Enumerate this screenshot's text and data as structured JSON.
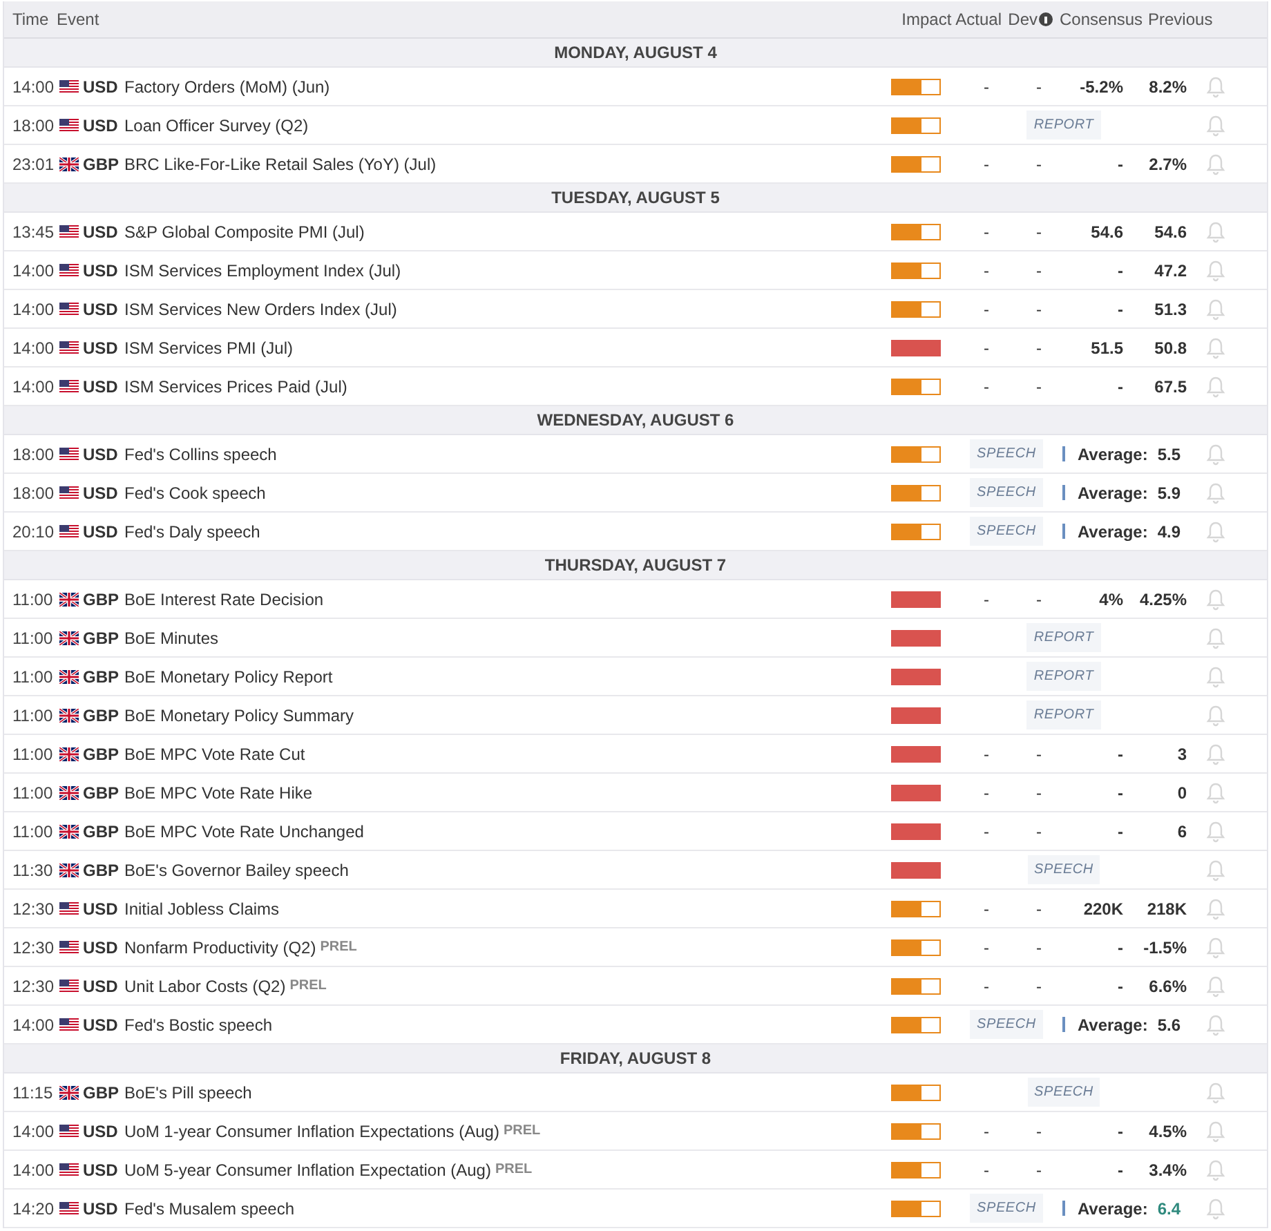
{
  "header": {
    "time": "Time",
    "event": "Event",
    "impact": "Impact",
    "actual": "Actual",
    "dev": "Dev",
    "consensus": "Consensus",
    "previous": "Previous"
  },
  "days": [
    {
      "date": "MONDAY, AUGUST 4",
      "events": [
        {
          "kind": "data",
          "time": "14:00",
          "flag": {
            "kind": "us"
          },
          "currency": "USD",
          "event": "Factory Orders (MoM) (Jun)",
          "impact": {
            "level": 0.62,
            "color": "#e8891c"
          },
          "actual": "-",
          "dev": "-",
          "consensus": "-5.2%",
          "previous": "8.2%"
        },
        {
          "kind": "tag",
          "time": "18:00",
          "flag": {
            "kind": "us"
          },
          "currency": "USD",
          "event": "Loan Officer Survey (Q2)",
          "impact": {
            "level": 0.62,
            "color": "#e8891c"
          },
          "tag": "REPORT"
        },
        {
          "kind": "data",
          "time": "23:01",
          "flag": {
            "kind": "gb"
          },
          "currency": "GBP",
          "event": "BRC Like-For-Like Retail Sales (YoY) (Jul)",
          "impact": {
            "level": 0.62,
            "color": "#e8891c"
          },
          "actual": "-",
          "dev": "-",
          "consensus": "-",
          "previous": "2.7%"
        }
      ]
    },
    {
      "date": "TUESDAY, AUGUST 5",
      "events": [
        {
          "kind": "data",
          "time": "13:45",
          "flag": {
            "kind": "us"
          },
          "currency": "USD",
          "event": "S&P Global Composite PMI (Jul)",
          "impact": {
            "level": 0.62,
            "color": "#e8891c"
          },
          "actual": "-",
          "dev": "-",
          "consensus": "54.6",
          "previous": "54.6"
        },
        {
          "kind": "data",
          "time": "14:00",
          "flag": {
            "kind": "us"
          },
          "currency": "USD",
          "event": "ISM Services Employment Index (Jul)",
          "impact": {
            "level": 0.62,
            "color": "#e8891c"
          },
          "actual": "-",
          "dev": "-",
          "consensus": "-",
          "previous": "47.2"
        },
        {
          "kind": "data",
          "time": "14:00",
          "flag": {
            "kind": "us"
          },
          "currency": "USD",
          "event": "ISM Services New Orders Index (Jul)",
          "impact": {
            "level": 0.62,
            "color": "#e8891c"
          },
          "actual": "-",
          "dev": "-",
          "consensus": "-",
          "previous": "51.3"
        },
        {
          "kind": "data",
          "time": "14:00",
          "flag": {
            "kind": "us"
          },
          "currency": "USD",
          "event": "ISM Services PMI (Jul)",
          "impact": {
            "level": 1,
            "color": "#d9534f"
          },
          "actual": "-",
          "dev": "-",
          "consensus": "51.5",
          "previous": "50.8"
        },
        {
          "kind": "data",
          "time": "14:00",
          "flag": {
            "kind": "us"
          },
          "currency": "USD",
          "event": "ISM Services Prices Paid (Jul)",
          "impact": {
            "level": 0.62,
            "color": "#e8891c"
          },
          "actual": "-",
          "dev": "-",
          "consensus": "-",
          "previous": "67.5"
        }
      ]
    },
    {
      "date": "WEDNESDAY, AUGUST 6",
      "events": [
        {
          "kind": "speech",
          "time": "18:00",
          "flag": {
            "kind": "us"
          },
          "currency": "USD",
          "event": "Fed's Collins speech",
          "impact": {
            "level": 0.62,
            "color": "#e8891c"
          },
          "tag": "SPEECH",
          "average_label": "Average:",
          "average": "5.5",
          "color": "#333333"
        },
        {
          "kind": "speech",
          "time": "18:00",
          "flag": {
            "kind": "us"
          },
          "currency": "USD",
          "event": "Fed's Cook speech",
          "impact": {
            "level": 0.62,
            "color": "#e8891c"
          },
          "tag": "SPEECH",
          "average_label": "Average:",
          "average": "5.9",
          "color": "#333333"
        },
        {
          "kind": "speech",
          "time": "20:10",
          "flag": {
            "kind": "us"
          },
          "currency": "USD",
          "event": "Fed's Daly speech",
          "impact": {
            "level": 0.62,
            "color": "#e8891c"
          },
          "tag": "SPEECH",
          "average_label": "Average:",
          "average": "4.9",
          "color": "#333333"
        }
      ]
    },
    {
      "date": "THURSDAY, AUGUST 7",
      "events": [
        {
          "kind": "data",
          "time": "11:00",
          "flag": {
            "kind": "gb"
          },
          "currency": "GBP",
          "event": "BoE Interest Rate Decision",
          "impact": {
            "level": 1,
            "color": "#d9534f"
          },
          "actual": "-",
          "dev": "-",
          "consensus": "4%",
          "previous": "4.25%"
        },
        {
          "kind": "tag",
          "time": "11:00",
          "flag": {
            "kind": "gb"
          },
          "currency": "GBP",
          "event": "BoE Minutes",
          "impact": {
            "level": 1,
            "color": "#d9534f"
          },
          "tag": "REPORT"
        },
        {
          "kind": "tag",
          "time": "11:00",
          "flag": {
            "kind": "gb"
          },
          "currency": "GBP",
          "event": "BoE Monetary Policy Report",
          "impact": {
            "level": 1,
            "color": "#d9534f"
          },
          "tag": "REPORT"
        },
        {
          "kind": "tag",
          "time": "11:00",
          "flag": {
            "kind": "gb"
          },
          "currency": "GBP",
          "event": "BoE Monetary Policy Summary",
          "impact": {
            "level": 1,
            "color": "#d9534f"
          },
          "tag": "REPORT"
        },
        {
          "kind": "data",
          "time": "11:00",
          "flag": {
            "kind": "gb"
          },
          "currency": "GBP",
          "event": "BoE MPC Vote Rate Cut",
          "impact": {
            "level": 1,
            "color": "#d9534f"
          },
          "actual": "-",
          "dev": "-",
          "consensus": "-",
          "previous": "3"
        },
        {
          "kind": "data",
          "time": "11:00",
          "flag": {
            "kind": "gb"
          },
          "currency": "GBP",
          "event": "BoE MPC Vote Rate Hike",
          "impact": {
            "level": 1,
            "color": "#d9534f"
          },
          "actual": "-",
          "dev": "-",
          "consensus": "-",
          "previous": "0"
        },
        {
          "kind": "data",
          "time": "11:00",
          "flag": {
            "kind": "gb"
          },
          "currency": "GBP",
          "event": "BoE MPC Vote Rate Unchanged",
          "impact": {
            "level": 1,
            "color": "#d9534f"
          },
          "actual": "-",
          "dev": "-",
          "consensus": "-",
          "previous": "6"
        },
        {
          "kind": "tag",
          "time": "11:30",
          "flag": {
            "kind": "gb"
          },
          "currency": "GBP",
          "event": "BoE's Governor Bailey speech",
          "impact": {
            "level": 1,
            "color": "#d9534f"
          },
          "tag": "SPEECH"
        },
        {
          "kind": "data",
          "time": "12:30",
          "flag": {
            "kind": "us"
          },
          "currency": "USD",
          "event": "Initial Jobless Claims",
          "impact": {
            "level": 0.62,
            "color": "#e8891c"
          },
          "actual": "-",
          "dev": "-",
          "consensus": "220K",
          "previous": "218K"
        },
        {
          "kind": "data",
          "time": "12:30",
          "flag": {
            "kind": "us"
          },
          "currency": "USD",
          "event": "Nonfarm Productivity (Q2)",
          "note": "PREL",
          "impact": {
            "level": 0.62,
            "color": "#e8891c"
          },
          "actual": "-",
          "dev": "-",
          "consensus": "-",
          "previous": "-1.5%"
        },
        {
          "kind": "data",
          "time": "12:30",
          "flag": {
            "kind": "us"
          },
          "currency": "USD",
          "event": "Unit Labor Costs (Q2)",
          "note": "PREL",
          "impact": {
            "level": 0.62,
            "color": "#e8891c"
          },
          "actual": "-",
          "dev": "-",
          "consensus": "-",
          "previous": "6.6%"
        },
        {
          "kind": "speech",
          "time": "14:00",
          "flag": {
            "kind": "us"
          },
          "currency": "USD",
          "event": "Fed's Bostic speech",
          "impact": {
            "level": 0.62,
            "color": "#e8891c"
          },
          "tag": "SPEECH",
          "average_label": "Average:",
          "average": "5.6",
          "color": "#333333"
        }
      ]
    },
    {
      "date": "FRIDAY, AUGUST 8",
      "events": [
        {
          "kind": "tag",
          "time": "11:15",
          "flag": {
            "kind": "gb"
          },
          "currency": "GBP",
          "event": "BoE's Pill speech",
          "impact": {
            "level": 0.62,
            "color": "#e8891c"
          },
          "tag": "SPEECH"
        },
        {
          "kind": "data",
          "time": "14:00",
          "flag": {
            "kind": "us"
          },
          "currency": "USD",
          "event": "UoM 1-year Consumer Inflation Expectations (Aug)",
          "note": "PREL",
          "impact": {
            "level": 0.62,
            "color": "#e8891c"
          },
          "actual": "-",
          "dev": "-",
          "consensus": "-",
          "previous": "4.5%"
        },
        {
          "kind": "data",
          "time": "14:00",
          "flag": {
            "kind": "us"
          },
          "currency": "USD",
          "event": "UoM 5-year Consumer Inflation Expectation (Aug)",
          "note": "PREL",
          "impact": {
            "level": 0.62,
            "color": "#e8891c"
          },
          "actual": "-",
          "dev": "-",
          "consensus": "-",
          "previous": "3.4%"
        },
        {
          "kind": "speech",
          "time": "14:20",
          "flag": {
            "kind": "us"
          },
          "currency": "USD",
          "event": "Fed's Musalem speech",
          "impact": {
            "level": 0.62,
            "color": "#e8891c"
          },
          "tag": "SPEECH",
          "average_label": "Average:",
          "average": "6.4",
          "color": "#2f8a7e"
        }
      ]
    }
  ]
}
